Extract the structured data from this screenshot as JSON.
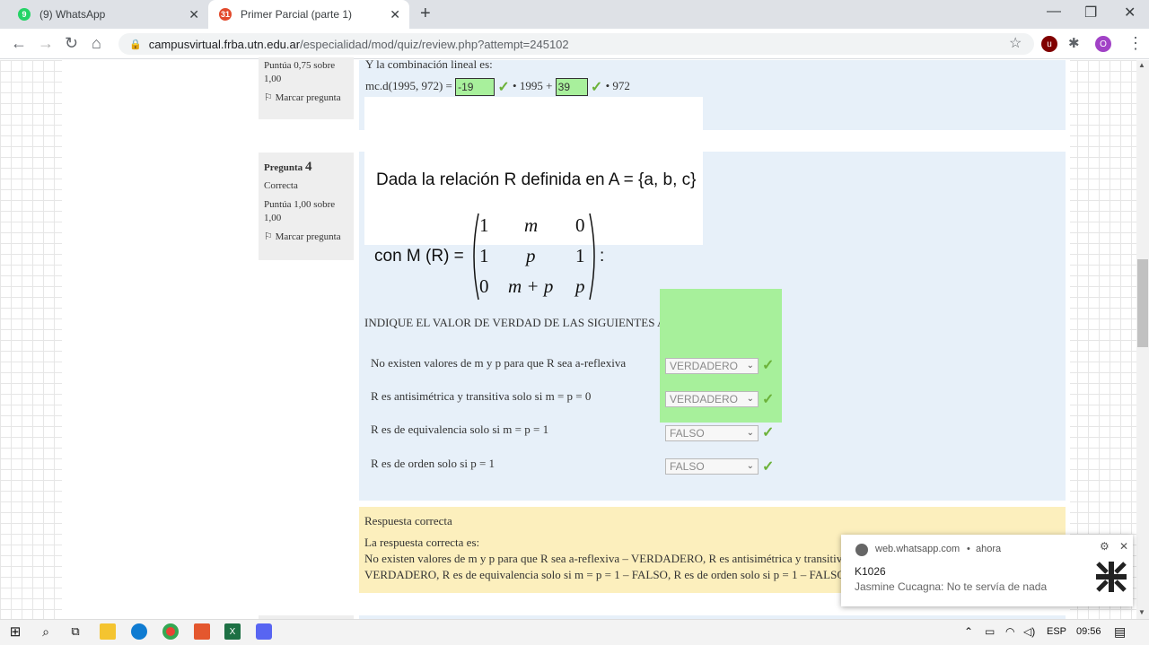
{
  "tabs": [
    {
      "label": "(9) WhatsApp",
      "badge": "9"
    },
    {
      "label": "Primer Parcial (parte 1)",
      "badge": "31"
    }
  ],
  "url": {
    "host": "campusvirtual.frba.utn.edu.ar",
    "path": "/especialidad/mod/quiz/review.php?attempt=245102"
  },
  "profile_initial": "O",
  "q3": {
    "score": "Puntúa 0,75 sobre 1,00",
    "flag": "Marcar pregunta",
    "intro": "Y la combinación lineal es:",
    "prefix": "mc.d(1995, 972) =",
    "ans1": "-19",
    "mid": "• 1995 +",
    "ans2": "39",
    "suffix": "• 972"
  },
  "q4": {
    "label": "Pregunta",
    "number": "4",
    "state": "Correcta",
    "score": "Puntúa 1,00 sobre 1,00",
    "flag": "Marcar pregunta",
    "heading": "Dada la relación R definida en A = {a, b, c}",
    "matrix_prefix": "con M (R) =",
    "matrix_suffix": ":",
    "matrix": [
      [
        "1",
        "m",
        "0"
      ],
      [
        "1",
        "p",
        "1"
      ],
      [
        "0",
        "m + p",
        "p"
      ]
    ],
    "instruction": "INDIQUE EL VALOR DE VERDAD DE LAS SIGUIENTES AFIRMACIONES:",
    "rows": [
      {
        "text": "No existen valores de m y p para que R sea a-reflexiva",
        "value": "VERDADERO"
      },
      {
        "text": "R es antisimétrica y transitiva  solo si  m = p = 0",
        "value": "VERDADERO"
      },
      {
        "text": "R es de equivalencia solo si  m = p = 1",
        "value": "FALSO"
      },
      {
        "text": "R es de orden solo si  p  = 1",
        "value": "FALSO"
      }
    ],
    "feedback_title": "Respuesta correcta",
    "feedback_intro": "La respuesta correcta es:",
    "feedback_line1": "No existen valores de m y p para que R sea a-reflexiva – VERDADERO, R es antisimétrica y transitiva  solo si  m = p = 0 –",
    "feedback_line2": "VERDADERO, R es de equivalencia solo si  m = p = 1 – FALSO, R es de orden solo si  p  = 1 – FALSO"
  },
  "notification": {
    "source": "web.whatsapp.com",
    "time": "ahora",
    "title": "K1026",
    "message": "Jasmine Cucagna: No te servía de nada"
  },
  "taskbar": {
    "lang": "ESP",
    "time": "09:56"
  }
}
